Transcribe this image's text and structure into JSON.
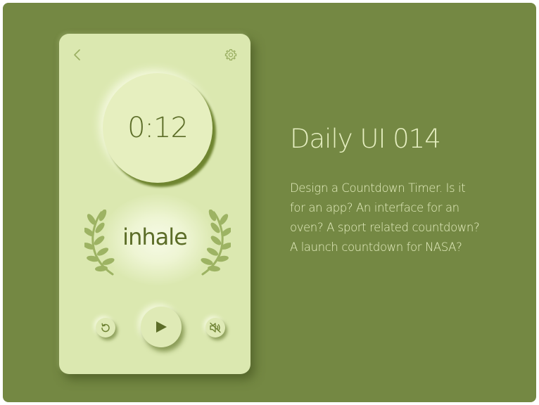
{
  "colors": {
    "background": "#748843",
    "card": "#dbe8b0",
    "accent_dark": "#5c6d28",
    "text_light": "#e5eec0",
    "laurel": "#9db363"
  },
  "timer": {
    "time": "0:12",
    "phase": "inhale"
  },
  "icons": {
    "back": "back-chevron-icon",
    "settings": "gear-icon",
    "replay": "replay-icon",
    "play": "play-icon",
    "mute": "speaker-muted-icon",
    "laurel": "laurel-branch-icon"
  },
  "info": {
    "title": "Daily UI 014",
    "description_lines": [
      "Design a Countdown Timer. Is it",
      "for an app? An interface for an",
      "oven? A sport related countdown?",
      "A launch countdown for NASA?"
    ]
  }
}
